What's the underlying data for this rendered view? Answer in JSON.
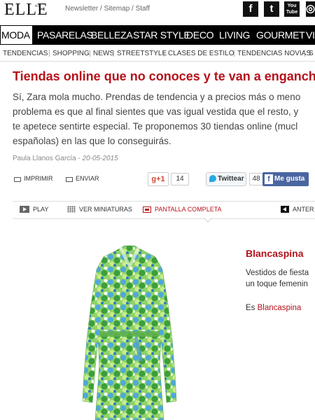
{
  "header": {
    "logo": "ELLE",
    "logo_sub": "es",
    "links": "Newsletter / Sitemap / Staff",
    "social": [
      {
        "name": "facebook-icon",
        "glyph": "f"
      },
      {
        "name": "twitter-icon",
        "glyph": "t"
      },
      {
        "name": "youtube-icon",
        "glyph": "You Tube"
      },
      {
        "name": "instagram-icon",
        "glyph": "◎"
      }
    ]
  },
  "main_nav": [
    "MODA",
    "PASARELAS",
    "BELLEZA",
    "STAR STYLE",
    "DECO",
    "LIVING",
    "GOURMET",
    "VI"
  ],
  "sub_nav": [
    "TENDENCIAS",
    "SHOPPING",
    "NEWS",
    "STREETSTYLE",
    "CLASES DE ESTILO",
    "TENDENCIAS NOVIAS",
    "S"
  ],
  "article": {
    "title": "Tiendas online que no conoces y te van a enganchar",
    "lead": [
      "Sí, Zara mola mucho. Prendas de tendencia y a precios más o meno",
      "problema es que al final sientes que vas igual vestida que el resto, y",
      "te apetece sentirte especial. Te proponemos 30 tiendas online (mucl",
      "españolas) en las que lo conseguirás."
    ],
    "author": "Paula Llanos García",
    "byline_sep": " - ",
    "date": "20-05-2015"
  },
  "share": {
    "print": "IMPRIMIR",
    "send": "ENVIAR",
    "gplus": "g+1",
    "gplus_count": "14",
    "tweet": "Twittear",
    "tweet_count": "48",
    "fb_like": "Me gusta"
  },
  "gallery": {
    "play": "PLAY",
    "thumbs": "VER MINIATURAS",
    "fullscreen": "PANTALLA COMPLETA",
    "prev": "ANTER"
  },
  "slide": {
    "title": "Blancaspina",
    "desc": [
      "Vestidos de fiesta",
      "un toque femenin"
    ],
    "link_prefix": "Es ",
    "link_text": "Blancaspina"
  },
  "colors": {
    "accent": "#b5121b",
    "nav_bg": "#000000",
    "facebook": "#4a66a0",
    "twitter": "#2aa9e0"
  }
}
